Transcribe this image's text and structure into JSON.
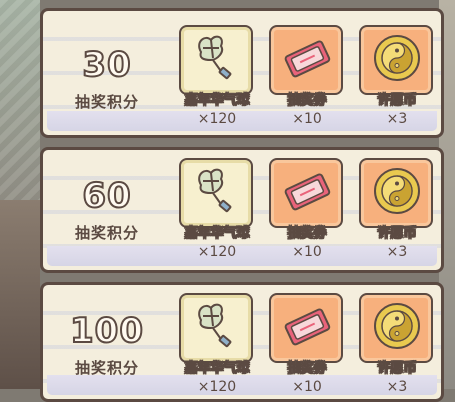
{
  "rewards": [
    {
      "score": "30",
      "score_label": "抽奖积分",
      "items": [
        {
          "name": "嘉年华气球",
          "count": "×120",
          "icon": "balloon-icon"
        },
        {
          "name": "抽奖券",
          "count": "×10",
          "icon": "ticket-icon"
        },
        {
          "name": "许愿币",
          "count": "×3",
          "icon": "coin-icon"
        }
      ]
    },
    {
      "score": "60",
      "score_label": "抽奖积分",
      "items": [
        {
          "name": "嘉年华气球",
          "count": "×120",
          "icon": "balloon-icon"
        },
        {
          "name": "抽奖券",
          "count": "×10",
          "icon": "ticket-icon"
        },
        {
          "name": "许愿币",
          "count": "×3",
          "icon": "coin-icon"
        }
      ]
    },
    {
      "score": "100",
      "score_label": "抽奖积分",
      "items": [
        {
          "name": "嘉年华气球",
          "count": "×120",
          "icon": "balloon-icon"
        },
        {
          "name": "抽奖券",
          "count": "×10",
          "icon": "ticket-icon"
        },
        {
          "name": "许愿币",
          "count": "×3",
          "icon": "coin-icon"
        }
      ]
    }
  ],
  "colors": {
    "panel": "#f4eedd",
    "border": "#5b4a42",
    "balloon_slot": "#f7f0cf",
    "orange_slot": "#f7b07d"
  }
}
